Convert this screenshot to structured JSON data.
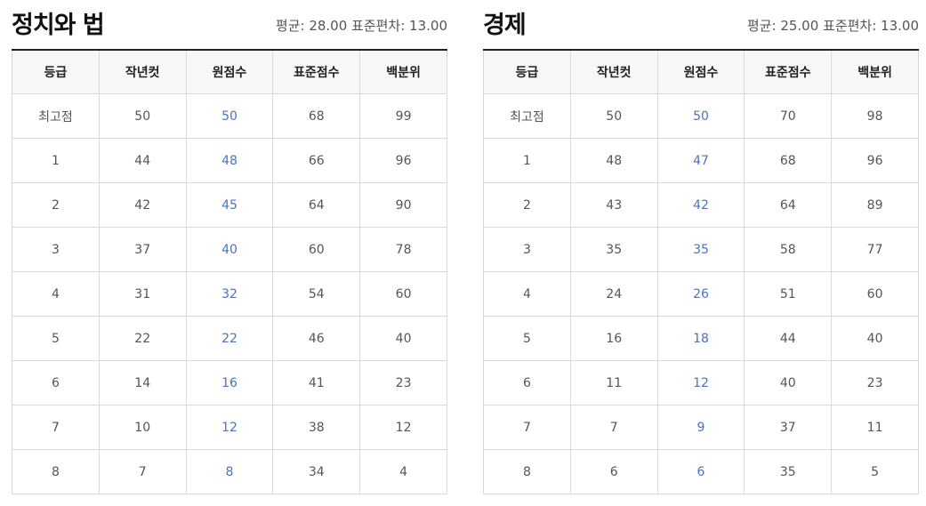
{
  "columns": [
    "등급",
    "작년컷",
    "원점수",
    "표준점수",
    "백분위"
  ],
  "subjects": [
    {
      "title": "정치와 법",
      "stats": "평균: 28.00 표준편차: 13.00",
      "rows": [
        [
          "최고점",
          "50",
          "50",
          "68",
          "99"
        ],
        [
          "1",
          "44",
          "48",
          "66",
          "96"
        ],
        [
          "2",
          "42",
          "45",
          "64",
          "90"
        ],
        [
          "3",
          "37",
          "40",
          "60",
          "78"
        ],
        [
          "4",
          "31",
          "32",
          "54",
          "60"
        ],
        [
          "5",
          "22",
          "22",
          "46",
          "40"
        ],
        [
          "6",
          "14",
          "16",
          "41",
          "23"
        ],
        [
          "7",
          "10",
          "12",
          "38",
          "12"
        ],
        [
          "8",
          "7",
          "8",
          "34",
          "4"
        ]
      ]
    },
    {
      "title": "경제",
      "stats": "평균: 25.00 표준편차: 13.00",
      "rows": [
        [
          "최고점",
          "50",
          "50",
          "70",
          "98"
        ],
        [
          "1",
          "48",
          "47",
          "68",
          "96"
        ],
        [
          "2",
          "43",
          "42",
          "64",
          "89"
        ],
        [
          "3",
          "35",
          "35",
          "58",
          "77"
        ],
        [
          "4",
          "24",
          "26",
          "51",
          "60"
        ],
        [
          "5",
          "16",
          "18",
          "44",
          "40"
        ],
        [
          "6",
          "11",
          "12",
          "40",
          "23"
        ],
        [
          "7",
          "7",
          "9",
          "37",
          "11"
        ],
        [
          "8",
          "6",
          "6",
          "35",
          "5"
        ]
      ]
    }
  ]
}
